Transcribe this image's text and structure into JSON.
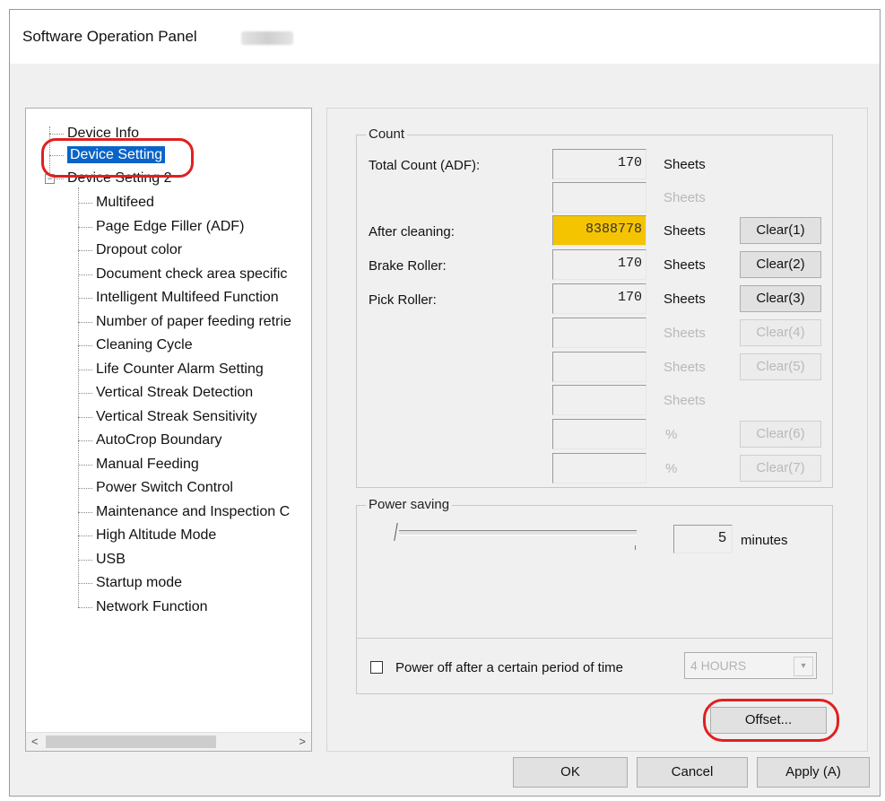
{
  "window": {
    "title": "Software Operation Panel"
  },
  "tree": {
    "items": [
      "Device Info",
      "Device Setting",
      "Device Setting 2",
      "Multifeed",
      "Page Edge Filler (ADF)",
      "Dropout color",
      "Document check area specific",
      "Intelligent Multifeed Function",
      "Number of paper feeding retrie",
      "Cleaning Cycle",
      "Life Counter Alarm Setting",
      "Vertical Streak Detection",
      "Vertical Streak Sensitivity",
      "AutoCrop Boundary",
      "Manual Feeding",
      "Power Switch Control",
      "Maintenance and Inspection C",
      "High Altitude Mode",
      "USB",
      "Startup mode",
      "Network Function"
    ],
    "selected": "Device Setting",
    "scroll_left": "<",
    "scroll_right": ">"
  },
  "count": {
    "title": "Count",
    "rows": [
      {
        "label": "Total Count (ADF):",
        "value": "170",
        "unit": "Sheets",
        "button": ""
      },
      {
        "label": "",
        "value": "",
        "unit": "Sheets",
        "button": ""
      },
      {
        "label": "After cleaning:",
        "value": "8388778",
        "unit": "Sheets",
        "button": "Clear(1)",
        "highlight": true
      },
      {
        "label": "Brake Roller:",
        "value": "170",
        "unit": "Sheets",
        "button": "Clear(2)"
      },
      {
        "label": "Pick Roller:",
        "value": "170",
        "unit": "Sheets",
        "button": "Clear(3)"
      },
      {
        "label": "",
        "value": "",
        "unit": "Sheets",
        "button": "Clear(4)"
      },
      {
        "label": "",
        "value": "",
        "unit": "Sheets",
        "button": "Clear(5)"
      },
      {
        "label": "",
        "value": "",
        "unit": "Sheets",
        "button": ""
      },
      {
        "label": "",
        "value": "",
        "unit": "%",
        "button": "Clear(6)"
      },
      {
        "label": "",
        "value": "",
        "unit": "%",
        "button": "Clear(7)"
      }
    ]
  },
  "power": {
    "title": "Power saving",
    "minutes_value": "5",
    "minutes_unit": "minutes",
    "checkbox_label": "Power off after a certain period of time",
    "hours_value": "4 HOURS",
    "dropdown_arrow": "▾"
  },
  "buttons": {
    "offset": "Offset...",
    "ok": "OK",
    "cancel": "Cancel",
    "apply": "Apply (A)"
  },
  "colors": {
    "highlight": "#f5c400",
    "selection": "#0a64c8",
    "annotation": "#e02020"
  }
}
